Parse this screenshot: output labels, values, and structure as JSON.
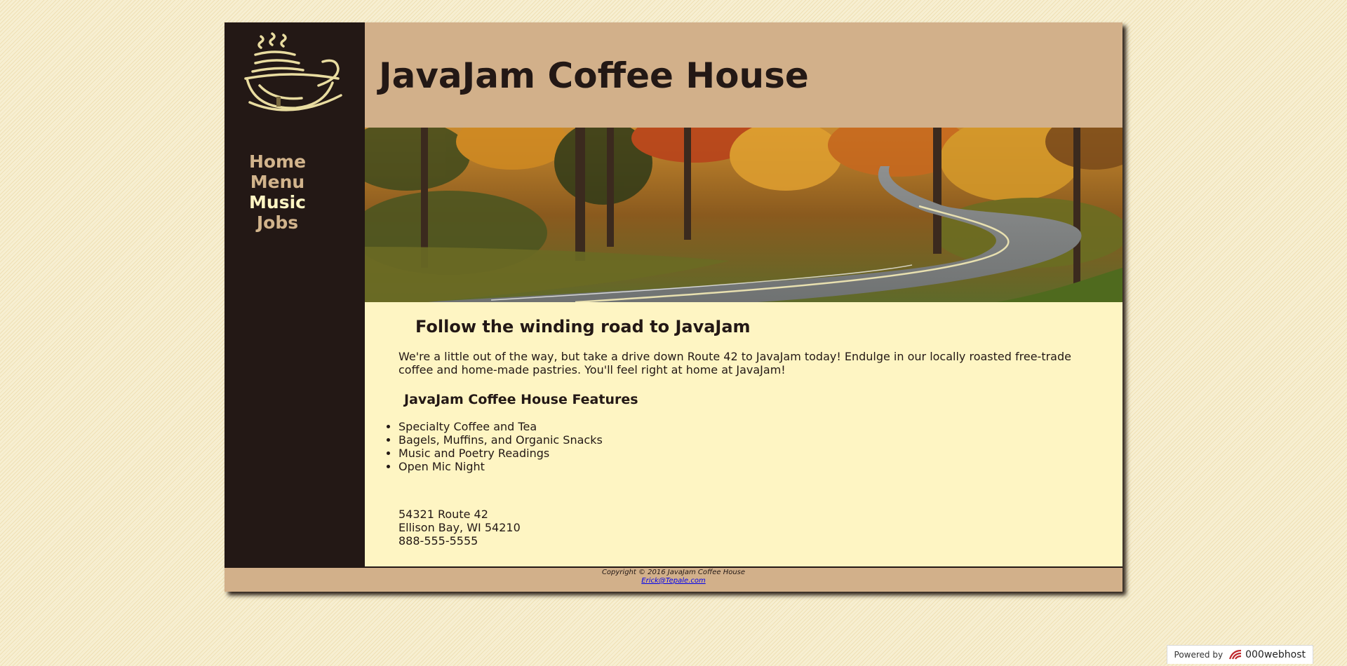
{
  "site": {
    "title": "JavaJam Coffee House"
  },
  "nav": {
    "items": [
      {
        "label": "Home",
        "active": false
      },
      {
        "label": "Menu",
        "active": false
      },
      {
        "label": "Music",
        "active": true
      },
      {
        "label": "Jobs",
        "active": false
      }
    ]
  },
  "main": {
    "heading": "Follow the winding road to JavaJam",
    "intro": "We're a little out of the way, but take a drive down Route 42 to JavaJam today! Endulge in our locally roasted free-trade coffee and home-made pastries. You'll feel right at home at JavaJam!",
    "features_heading": "JavaJam Coffee House Features",
    "features": [
      "Specialty Coffee and Tea",
      "Bagels, Muffins, and Organic Snacks",
      "Music and Poetry Readings",
      "Open Mic Night"
    ],
    "address": {
      "street": "54321 Route 42",
      "city": "Ellison Bay, WI 54210",
      "phone": "888-555-5555"
    }
  },
  "footer": {
    "copyright": "Copyright © 2016 JavaJam Coffee House",
    "email": "Erick@Tepale.com"
  },
  "badge": {
    "prefix": "Powered by",
    "brand": "000webhost"
  },
  "colors": {
    "sidebar": "#231815",
    "header": "#d2b08a",
    "content": "#fef5c3",
    "nav_link": "#d2b48c",
    "nav_active": "#fef5c3"
  }
}
